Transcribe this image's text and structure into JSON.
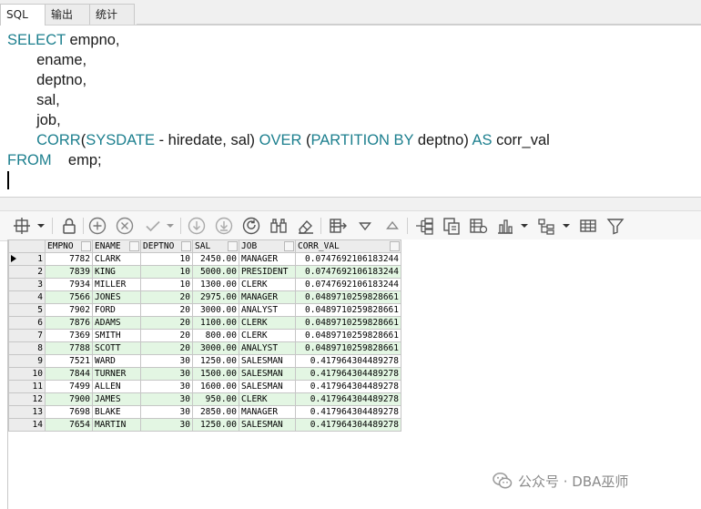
{
  "tabs": [
    {
      "label": "SQL",
      "active": true
    },
    {
      "label": "输出",
      "active": false
    },
    {
      "label": "统计",
      "active": false
    }
  ],
  "editor": {
    "lines": [
      [
        {
          "t": "SELECT",
          "k": true
        },
        {
          "t": " empno,",
          "k": false
        }
      ],
      [
        {
          "t": "       ename,",
          "k": false
        }
      ],
      [
        {
          "t": "       deptno,",
          "k": false
        }
      ],
      [
        {
          "t": "       sal,",
          "k": false
        }
      ],
      [
        {
          "t": "       job,",
          "k": false
        }
      ],
      [
        {
          "t": "       ",
          "k": false
        },
        {
          "t": "CORR",
          "k": true
        },
        {
          "t": "(",
          "k": false
        },
        {
          "t": "SYSDATE",
          "k": true
        },
        {
          "t": " - hiredate, sal) ",
          "k": false
        },
        {
          "t": "OVER",
          "k": true
        },
        {
          "t": " (",
          "k": false
        },
        {
          "t": "PARTITION BY",
          "k": true
        },
        {
          "t": " deptno) ",
          "k": false
        },
        {
          "t": "AS",
          "k": true
        },
        {
          "t": " corr_val",
          "k": false
        }
      ],
      [
        {
          "t": "FROM",
          "k": true
        },
        {
          "t": "    emp;",
          "k": false
        }
      ]
    ]
  },
  "toolbar": {
    "icons": [
      "grid-menu-icon",
      "lock-icon",
      "add-record-icon",
      "delete-record-icon",
      "post-edit-icon",
      "fetch-next-icon",
      "fetch-last-icon",
      "refresh-icon",
      "find-icon",
      "clear-icon",
      "export-icon",
      "sort-desc-icon",
      "sort-asc-icon",
      "tree-icon",
      "copy-icon",
      "print-icon",
      "chart-icon",
      "group-icon",
      "table-view-icon",
      "filter-icon"
    ]
  },
  "grid": {
    "columns": [
      "EMPNO",
      "ENAME",
      "DEPTNO",
      "SAL",
      "JOB",
      "CORR_VAL"
    ],
    "rows": [
      [
        "1",
        "7782",
        "CLARK",
        "10",
        "2450.00",
        "MANAGER",
        "0.0747692106183244"
      ],
      [
        "2",
        "7839",
        "KING",
        "10",
        "5000.00",
        "PRESIDENT",
        "0.0747692106183244"
      ],
      [
        "3",
        "7934",
        "MILLER",
        "10",
        "1300.00",
        "CLERK",
        "0.0747692106183244"
      ],
      [
        "4",
        "7566",
        "JONES",
        "20",
        "2975.00",
        "MANAGER",
        "0.0489710259828661"
      ],
      [
        "5",
        "7902",
        "FORD",
        "20",
        "3000.00",
        "ANALYST",
        "0.0489710259828661"
      ],
      [
        "6",
        "7876",
        "ADAMS",
        "20",
        "1100.00",
        "CLERK",
        "0.0489710259828661"
      ],
      [
        "7",
        "7369",
        "SMITH",
        "20",
        "800.00",
        "CLERK",
        "0.0489710259828661"
      ],
      [
        "8",
        "7788",
        "SCOTT",
        "20",
        "3000.00",
        "ANALYST",
        "0.0489710259828661"
      ],
      [
        "9",
        "7521",
        "WARD",
        "30",
        "1250.00",
        "SALESMAN",
        "0.417964304489278"
      ],
      [
        "10",
        "7844",
        "TURNER",
        "30",
        "1500.00",
        "SALESMAN",
        "0.417964304489278"
      ],
      [
        "11",
        "7499",
        "ALLEN",
        "30",
        "1600.00",
        "SALESMAN",
        "0.417964304489278"
      ],
      [
        "12",
        "7900",
        "JAMES",
        "30",
        "950.00",
        "CLERK",
        "0.417964304489278"
      ],
      [
        "13",
        "7698",
        "BLAKE",
        "30",
        "2850.00",
        "MANAGER",
        "0.417964304489278"
      ],
      [
        "14",
        "7654",
        "MARTIN",
        "30",
        "1250.00",
        "SALESMAN",
        "0.417964304489278"
      ]
    ],
    "current_row": 1
  },
  "watermark": {
    "text": "公众号 · DBA巫师"
  },
  "colors": {
    "keyword": "#1c7f8e",
    "row_alt": "#e3f6e3",
    "header": "#ececec"
  }
}
